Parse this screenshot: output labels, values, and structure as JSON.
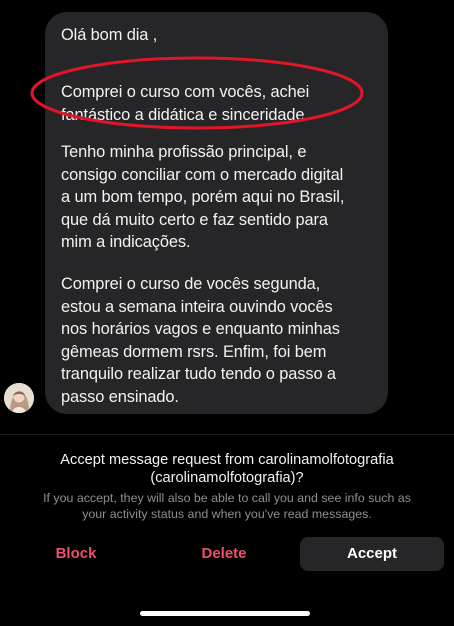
{
  "message": {
    "greeting": "Olá bom dia ,",
    "para2": [
      "Comprei o curso com vocês, achei",
      "fantástico a didática e sinceridade."
    ],
    "para3": [
      "Tenho minha profissão principal, e",
      "consigo conciliar com o mercado digital",
      "a um bom tempo, porém aqui no Brasil,",
      "que dá muito certo e faz sentido para",
      "mim a indicações."
    ],
    "para4": [
      "Comprei o curso de vocês segunda,",
      "estou a semana inteira ouvindo vocês",
      "nos horários vagos e enquanto minhas",
      "gêmeas dormem rsrs. Enfim, foi bem",
      "tranquilo realizar tudo tendo o passo a",
      "passo ensinado."
    ]
  },
  "highlight_color": "#e0152a",
  "request": {
    "title_line1": "Accept message request from carolinamolfotografia",
    "title_line2": "(carolinamolfotografia)?",
    "desc_line1": "If you accept, they will also be able to call you and see info such as",
    "desc_line2": "your activity status and when you've read messages."
  },
  "actions": {
    "block_label": "Block",
    "delete_label": "Delete",
    "accept_label": "Accept"
  },
  "colors": {
    "background": "#000000",
    "bubble": "#262628",
    "destructive": "#ef4f6b",
    "secondary_text": "#8e8e93"
  }
}
